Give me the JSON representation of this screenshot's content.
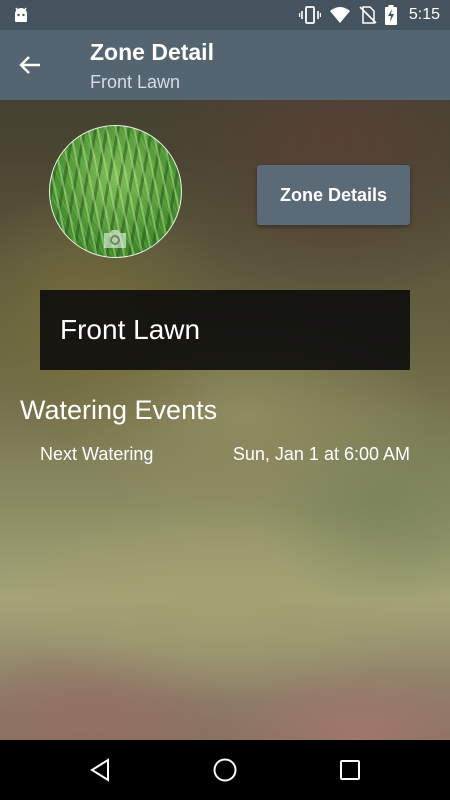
{
  "status_bar": {
    "time": "5:15",
    "icons": [
      "android-icon",
      "vibrate-icon",
      "wifi-icon",
      "no-sim-icon",
      "battery-charging-icon"
    ]
  },
  "app_bar": {
    "title": "Zone Detail",
    "subtitle": "Front Lawn",
    "back_icon": "arrow-left-icon"
  },
  "zone": {
    "photo_icon": "camera-icon",
    "details_button_label": "Zone Details",
    "name": "Front Lawn"
  },
  "watering": {
    "section_title": "Watering Events",
    "events": [
      {
        "label": "Next Watering",
        "value": "Sun, Jan 1 at 6:00 AM"
      }
    ]
  },
  "nav_bar": {
    "icons": [
      "back-triangle-icon",
      "home-circle-icon",
      "recents-square-icon"
    ]
  },
  "colors": {
    "status_bar": "#45535e",
    "app_bar": "#546571",
    "button": "#5a6b77",
    "name_panel": "#0a0a0a",
    "nav_bar": "#000000"
  }
}
